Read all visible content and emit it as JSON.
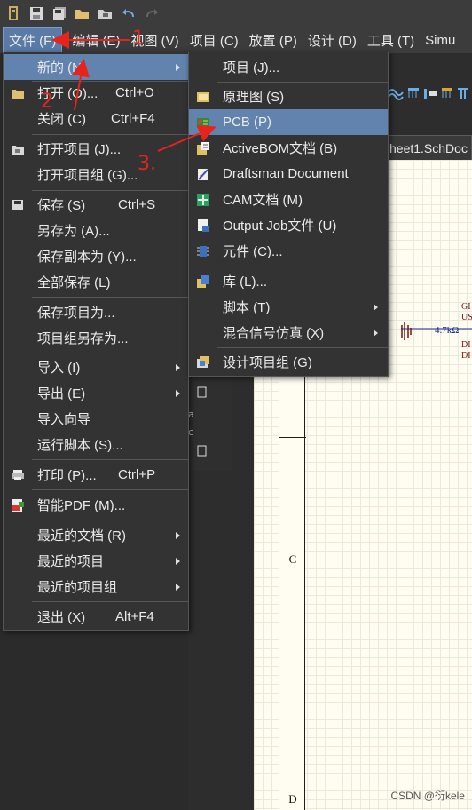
{
  "toolbar": {
    "icons": [
      "app-logo-icon",
      "save-icon",
      "save-all-icon",
      "open-folder-icon",
      "open-project-icon",
      "undo-icon",
      "redo-icon"
    ]
  },
  "menubar": {
    "items": [
      "文件 (F)",
      "编辑 (E)",
      "视图 (V)",
      "项目 (C)",
      "放置 (P)",
      "设计 (D)",
      "工具 (T)",
      "Simu"
    ]
  },
  "document_tab": "heet1.SchDoc",
  "sheet": {
    "resistor_label": "4.7kΩ",
    "net_labels": [
      "GI",
      "US",
      "DI",
      "DI"
    ],
    "zones": [
      "C",
      "D"
    ]
  },
  "file_menu": {
    "new": "新的 (N)",
    "open": "打开 (O)...",
    "open_shortcut": "Ctrl+O",
    "close": "关闭 (C)",
    "close_shortcut": "Ctrl+F4",
    "open_project": "打开项目 (J)...",
    "open_project_group": "打开项目组 (G)...",
    "save": "保存 (S)",
    "save_shortcut": "Ctrl+S",
    "save_as": "另存为 (A)...",
    "save_copy_as": "保存副本为 (Y)...",
    "save_all": "全部保存 (L)",
    "save_project_as": "保存项目为...",
    "save_project_group_as": "项目组另存为...",
    "import": "导入 (I)",
    "export": "导出 (E)",
    "import_wizard": "导入向导",
    "run_script": "运行脚本 (S)...",
    "print": "打印 (P)...",
    "print_shortcut": "Ctrl+P",
    "smart_pdf": "智能PDF (M)...",
    "recent_docs": "最近的文档 (R)",
    "recent_projects": "最近的项目",
    "recent_project_groups": "最近的项目组",
    "exit": "退出 (X)",
    "exit_shortcut": "Alt+F4"
  },
  "new_submenu": {
    "project": "项目 (J)...",
    "schematic": "原理图 (S)",
    "pcb": "PCB (P)",
    "activebom": "ActiveBOM文档 (B)",
    "draftsman": "Draftsman Document",
    "cam": "CAM文档 (M)",
    "output_job": "Output Job文件 (U)",
    "component": "元件 (C)...",
    "library": "库 (L)...",
    "script": "脚本 (T)",
    "mixed_sim": "混合信号仿真 (X)",
    "design_project_group": "设计项目组 (G)"
  },
  "annotations": {
    "step1": "1",
    "step2": "2",
    "step3": "3."
  },
  "colors": {
    "menu_bg": "#333333",
    "highlight": "#6283ad",
    "annotation": "#e8231c"
  },
  "watermark": "CSDN @衍kele"
}
